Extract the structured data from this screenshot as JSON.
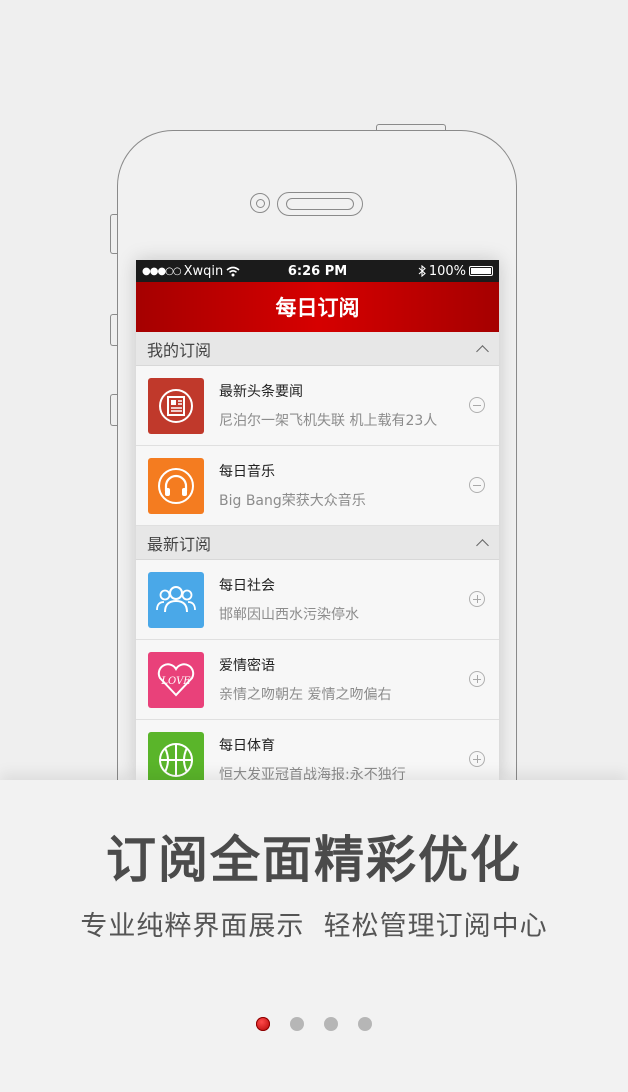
{
  "status_bar": {
    "signal": "●●●○○",
    "carrier": "Xwqin",
    "time": "6:26 PM",
    "battery": "100%",
    "battery_level": 1.0
  },
  "app": {
    "title": "每日订阅"
  },
  "sections": [
    {
      "heading": "我的订阅",
      "items": [
        {
          "title": "最新头条要闻",
          "subtitle": "尼泊尔一架飞机失联 机上载有23人",
          "icon": "newspaper-icon",
          "color": "#c0392b",
          "action": "remove"
        },
        {
          "title": "每日音乐",
          "subtitle": "Big Bang荣获大众音乐",
          "icon": "headphones-icon",
          "color": "#f47c20",
          "action": "remove"
        }
      ]
    },
    {
      "heading": "最新订阅",
      "items": [
        {
          "title": "每日社会",
          "subtitle": "邯郸因山西水污染停水",
          "icon": "people-icon",
          "color": "#4aa8e8",
          "action": "add"
        },
        {
          "title": "爱情密语",
          "subtitle": "亲情之吻朝左 爱情之吻偏右",
          "icon": "heart-love-icon",
          "color": "#e9417a",
          "action": "add"
        },
        {
          "title": "每日体育",
          "subtitle": "恒大发亚冠首战海报:永不独行",
          "icon": "basketball-icon",
          "color": "#5ab52a",
          "action": "add"
        }
      ]
    }
  ],
  "promo": {
    "headline": "订阅全面精彩优化",
    "subline": "专业纯粹界面展示  轻松管理订阅中心"
  },
  "pager": {
    "count": 4,
    "active_index": 0
  }
}
